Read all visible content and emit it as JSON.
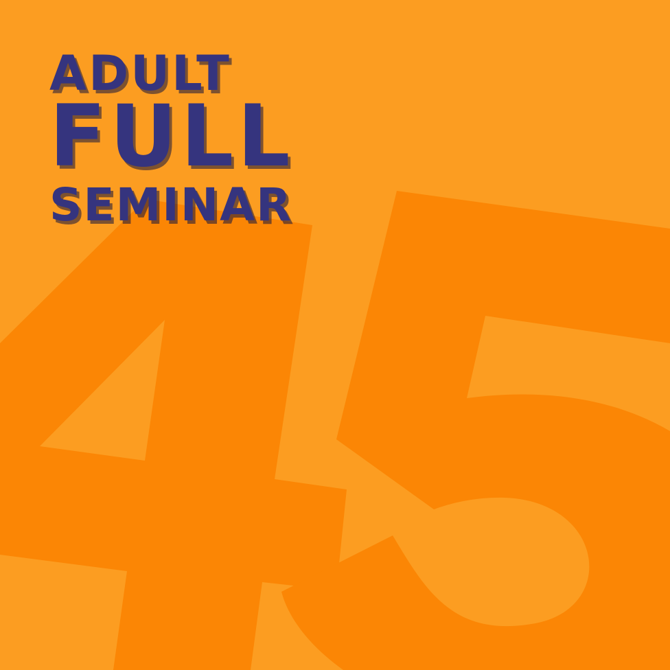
{
  "colors": {
    "background": "#fc9d21",
    "numeral": "#fb8605",
    "title": "#35347e",
    "shadow": "#1e1e46"
  },
  "title": {
    "line1": "ADULT",
    "line2": "FULL",
    "line3": "SEMINAR"
  },
  "background_numeral": "45"
}
